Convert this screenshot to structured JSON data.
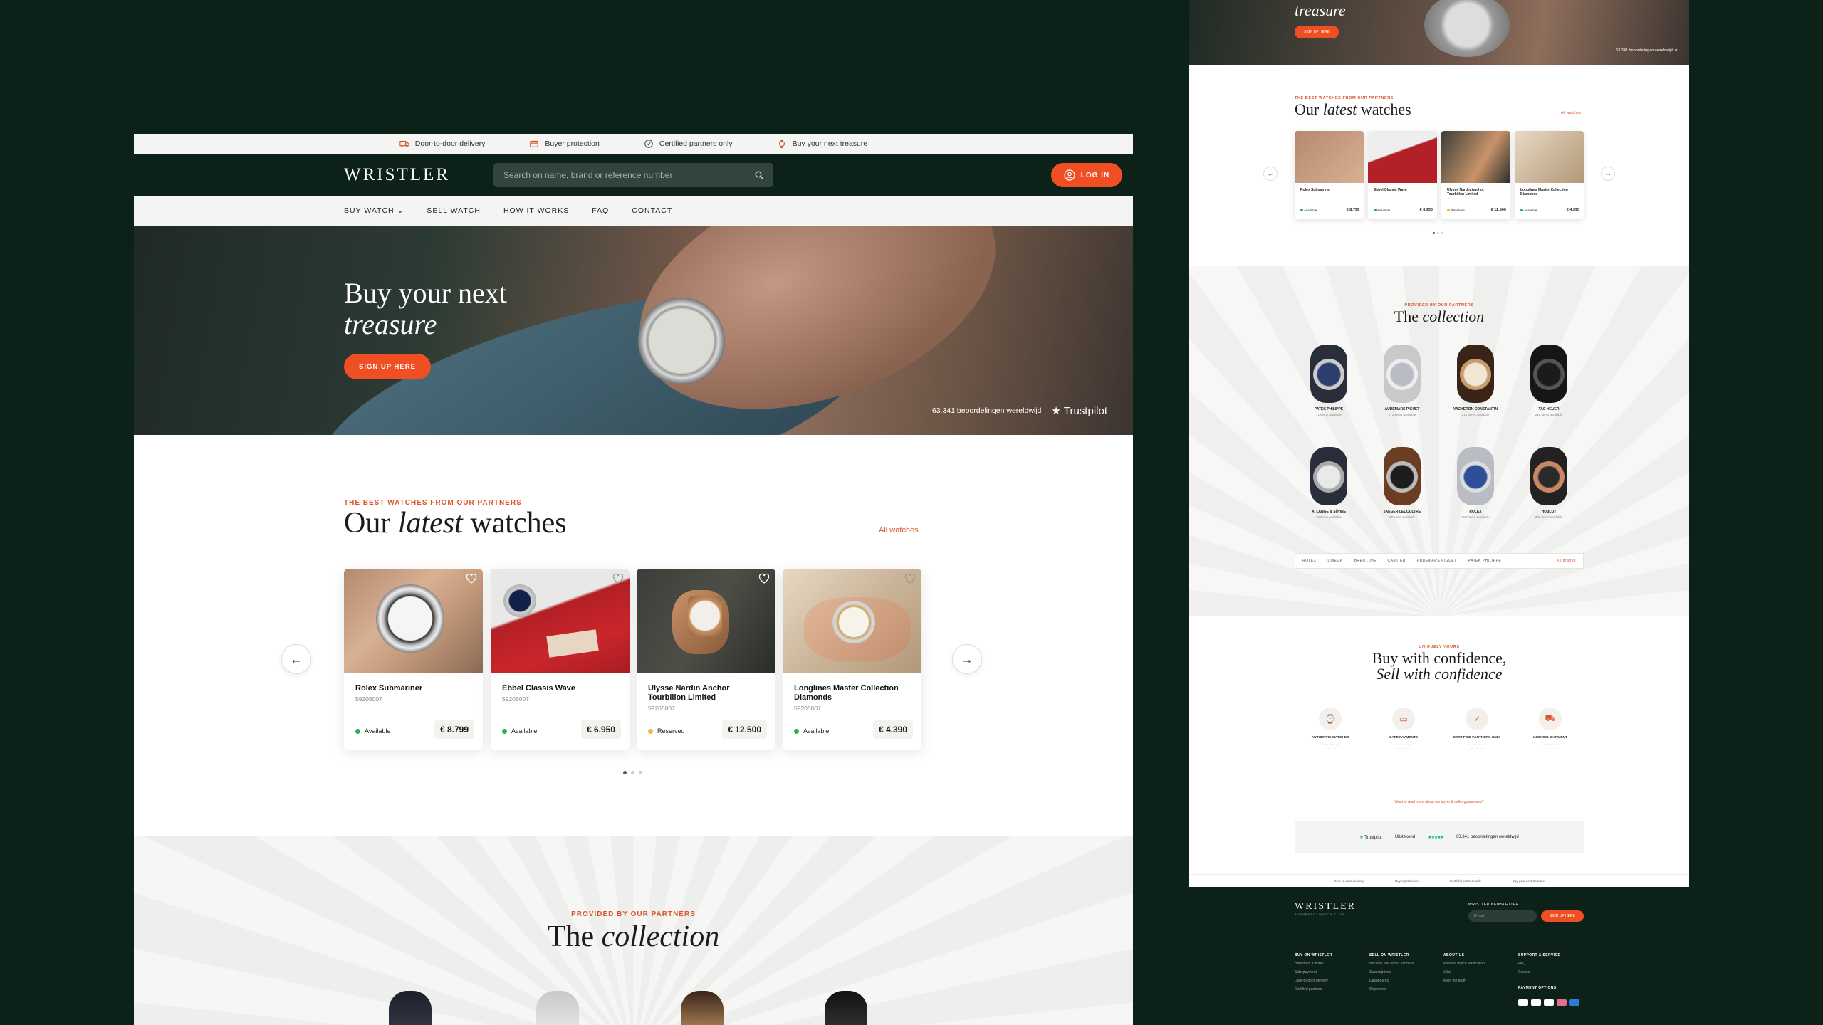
{
  "topbar": {
    "items": [
      {
        "label": "Door-to-door delivery",
        "icon": "truck-icon"
      },
      {
        "label": "Buyer protection",
        "icon": "wallet-icon"
      },
      {
        "label": "Certified partners only",
        "icon": "certificate-icon"
      },
      {
        "label": "Buy your next treasure",
        "icon": "watch-icon"
      }
    ]
  },
  "header": {
    "logo": "WRISTLER",
    "search_placeholder": "Search on name, brand or reference number",
    "login_label": "LOG IN"
  },
  "nav": {
    "items": [
      "BUY WATCH",
      "SELL WATCH",
      "HOW IT WORKS",
      "FAQ",
      "CONTACT"
    ]
  },
  "hero": {
    "title_line1": "Buy your next",
    "title_line2": "treasure",
    "cta_label": "SIGN UP HERE",
    "reviews_text": "63.341 beoordelingen wereldwijd",
    "trustpilot_label": "Trustpilot"
  },
  "latest": {
    "kicker": "THE BEST WATCHES FROM OUR PARTNERS",
    "title_pre": "Our ",
    "title_italic": "latest",
    "title_post": " watches",
    "all_link": "All watches",
    "cards": [
      {
        "name": "Rolex Submariner",
        "ref": "59205007",
        "status": "Available",
        "price": "€ 8.799",
        "status_color": "#2fae5a"
      },
      {
        "name": "Ebbel Classis Wave",
        "ref": "59205007",
        "status": "Available",
        "price": "€ 6.950",
        "status_color": "#2fae5a"
      },
      {
        "name": "Ulysse Nardin Anchor Tourbillon Limited",
        "ref": "59205007",
        "status": "Reserved",
        "price": "€ 12.500",
        "status_color": "#f2b441"
      },
      {
        "name": "Longlines Master Collection Diamonds",
        "ref": "59205007",
        "status": "Available",
        "price": "€ 4.390",
        "status_color": "#2fae5a"
      }
    ]
  },
  "collection": {
    "kicker": "PROVIDED BY OUR PARTNERS",
    "title_pre": "The ",
    "title_italic": "collection"
  },
  "side": {
    "hero_title": "treasure",
    "hero_cta": "SIGN UP HERE",
    "hero_reviews": "63.341 beoordelingen wereldwijd",
    "latest_kicker": "THE BEST WATCHES FROM OUR PARTNERS",
    "latest_title_pre": "Our ",
    "latest_title_italic": "latest",
    "latest_title_post": " watches",
    "latest_all": "All watches",
    "cards": [
      {
        "name": "Rolex Submariner",
        "price": "€ 8.799",
        "status": "Available"
      },
      {
        "name": "Ebbel Classis Wave",
        "price": "€ 6.950",
        "status": "Available"
      },
      {
        "name": "Ulysse Nardin Anchor Tourbillon Limited",
        "price": "€ 12.500",
        "status": "Reserved"
      },
      {
        "name": "Longlines Master Collection Diamonds",
        "price": "€ 4.390",
        "status": "Available"
      }
    ],
    "coll_kicker": "PROVIDED BY OUR PARTNERS",
    "coll_title_pre": "The ",
    "coll_title_italic": "collection",
    "brands_row1": [
      {
        "name": "PATEK PHILIPPE",
        "count": "71 items available"
      },
      {
        "name": "AUDEMARS PIGUET",
        "count": "172 items available"
      },
      {
        "name": "VACHERON CONSTANTIN",
        "count": "216 items available"
      },
      {
        "name": "TAG HEUER",
        "count": "219 items available"
      }
    ],
    "brands_row2": [
      {
        "name": "A. LANGE & SÖHNE",
        "count": "76 items available"
      },
      {
        "name": "JAEGER-LECOULTRE",
        "count": "83 items available"
      },
      {
        "name": "ROLEX",
        "count": "588 items available"
      },
      {
        "name": "HUBLOT",
        "count": "372 items available"
      }
    ],
    "brand_filters": [
      "ROLEX",
      "OMEGA",
      "BREITLING",
      "CARTIER",
      "AUDEMARS PIGUET",
      "PATEK PHILIPPE"
    ],
    "brand_all": "All brands",
    "conf_kicker": "UNIQUELY YOURS",
    "conf_line1": "Buy with confidence,",
    "conf_line2": "Sell with confidence",
    "features": [
      {
        "title": "AUTHENTIC WATCHES",
        "icon": "watch-icon"
      },
      {
        "title": "SAFE PAYMENTS",
        "icon": "wallet-icon"
      },
      {
        "title": "CERTIFIED PARTNERS ONLY",
        "icon": "certificate-icon"
      },
      {
        "title": "INSURED SHIPMENT",
        "icon": "truck-icon"
      }
    ],
    "conf_link": "Want to read more about our buyer & seller guarantees?",
    "trust_label": "Trustpilot",
    "trust_rating": "Uitstekend",
    "trust_reviews": "63.341 beoordelingen wereldwijd",
    "strip": [
      "Door-to-door delivery",
      "Buyer protection",
      "Certified partners only",
      "Buy your next treasure"
    ],
    "footer_logo": "WRISTLER",
    "footer_tagline": "AUTHENTIC WATCH CLUB",
    "newsletter_label": "WRISTLER NEWSLETTER",
    "newsletter_placeholder": "E-mail",
    "newsletter_button": "SIGN UP HERE",
    "footer_cols": [
      {
        "title": "BUY ON WRISTLER",
        "links": [
          "How does it work?",
          "Safe payment",
          "Door-to-door delivery",
          "Certified partners"
        ]
      },
      {
        "title": "SELL ON WRISTLER",
        "links": [
          "Become one of our partners",
          "Subscriptions",
          "Dashboards",
          "Shipments"
        ]
      },
      {
        "title": "ABOUT US",
        "links": [
          "Process watch verification",
          "Jobs",
          "Meet the team"
        ]
      },
      {
        "title": "SUPPORT & SERVICE",
        "links": [
          "FAQ",
          "Contact"
        ]
      }
    ],
    "payment_label": "PAYMENT OPTIONS"
  }
}
